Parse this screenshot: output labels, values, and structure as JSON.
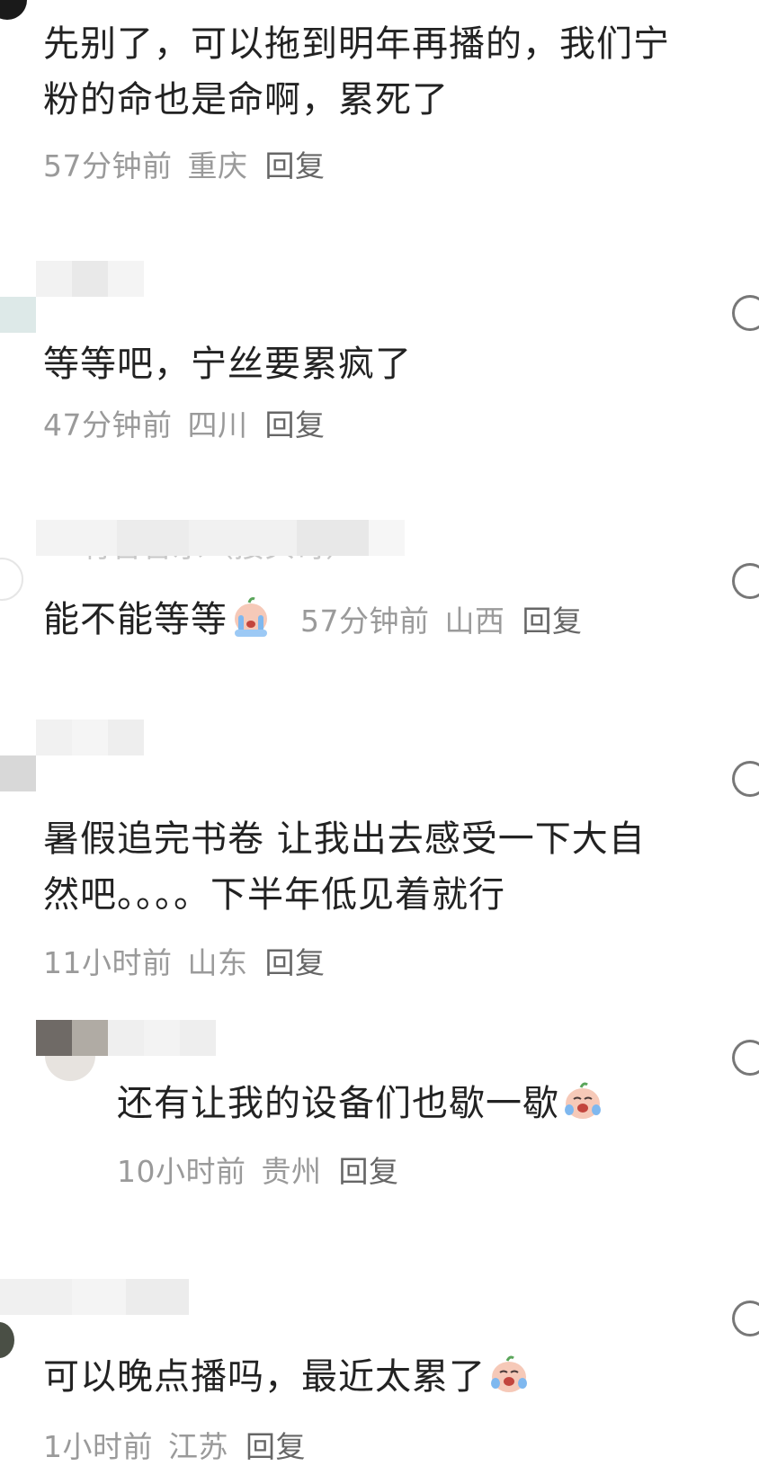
{
  "comments": [
    {
      "text": "先别了，可以拖到明年再播的，我们宁粉的命也是命啊，累死了",
      "time": "57分钟前",
      "region": "重庆",
      "reply": "回复"
    },
    {
      "text": "等等吧，宁丝要累疯了",
      "time": "47分钟前",
      "region": "四川",
      "reply": "回复"
    },
    {
      "partial_name": "有音音乐（接头哥）",
      "text": "能不能等等",
      "time": "57分钟前",
      "region": "山西",
      "reply": "回复"
    },
    {
      "text": "暑假追完书卷 让我出去感受一下大自然吧。。。。下半年低见着就行",
      "time": "11小时前",
      "region": "山东",
      "reply": "回复"
    },
    {
      "text": "还有让我的设备们也歇一歇",
      "time": "10小时前",
      "region": "贵州",
      "reply": "回复"
    },
    {
      "text": "可以晚点播吗，最近太累了",
      "time": "1小时前",
      "region": "江苏",
      "reply": "回复"
    }
  ],
  "icons": {
    "crying_emoji": "crying-emoji-icon",
    "like": "like-icon"
  },
  "colors": {
    "text": "#222222",
    "meta": "#9a9a9a",
    "reply": "#666666"
  }
}
